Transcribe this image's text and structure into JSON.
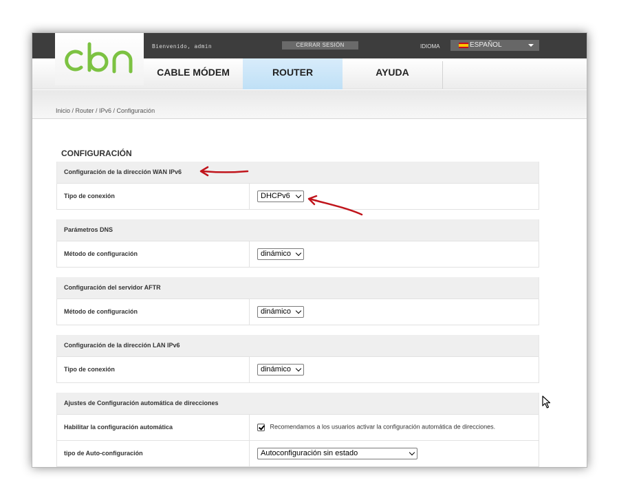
{
  "header": {
    "welcome": "Bienvenido, admin",
    "logout_label": "CERRAR SESIÓN",
    "language_label": "IDIOMA",
    "language_value": "ESPAÑOL"
  },
  "logo": {
    "icon": "cbn-logo",
    "color": "#7cc242"
  },
  "nav": {
    "items": [
      {
        "label": "CABLE MÓDEM"
      },
      {
        "label": "ROUTER"
      },
      {
        "label": "AYUDA"
      }
    ],
    "active_color": "#c7e5f8"
  },
  "breadcrumb": "Inicio / Router / IPv6 / Configuración",
  "page_title": "CONFIGURACIÓN",
  "sections": {
    "wan": {
      "title": "Configuración de la dirección WAN IPv6",
      "row_label": "Tipo de conexión",
      "value": "DHCPv6"
    },
    "dns": {
      "title": "Parámetros DNS",
      "row_label": "Método de configuración",
      "value": "dinámico"
    },
    "aftr": {
      "title": "Configuración del servidor AFTR",
      "row_label": "Método de configuración",
      "value": "dinámico"
    },
    "lan": {
      "title": "Configuración de la dirección LAN IPv6",
      "row_label": "Tipo de conexión",
      "value": "dinámico"
    },
    "autoconf": {
      "title": "Ajustes de Configuración automática de direcciones",
      "enable_label": "Habilitar la configuración automática",
      "enable_checked": true,
      "enable_note": "Recomendamos a los usuarios activar la configuración automática de direcciones.",
      "type_label": "tipo de Auto-configuración",
      "type_value": "Autoconfiguración sin estado"
    }
  },
  "annotation_color": "#c0141b"
}
